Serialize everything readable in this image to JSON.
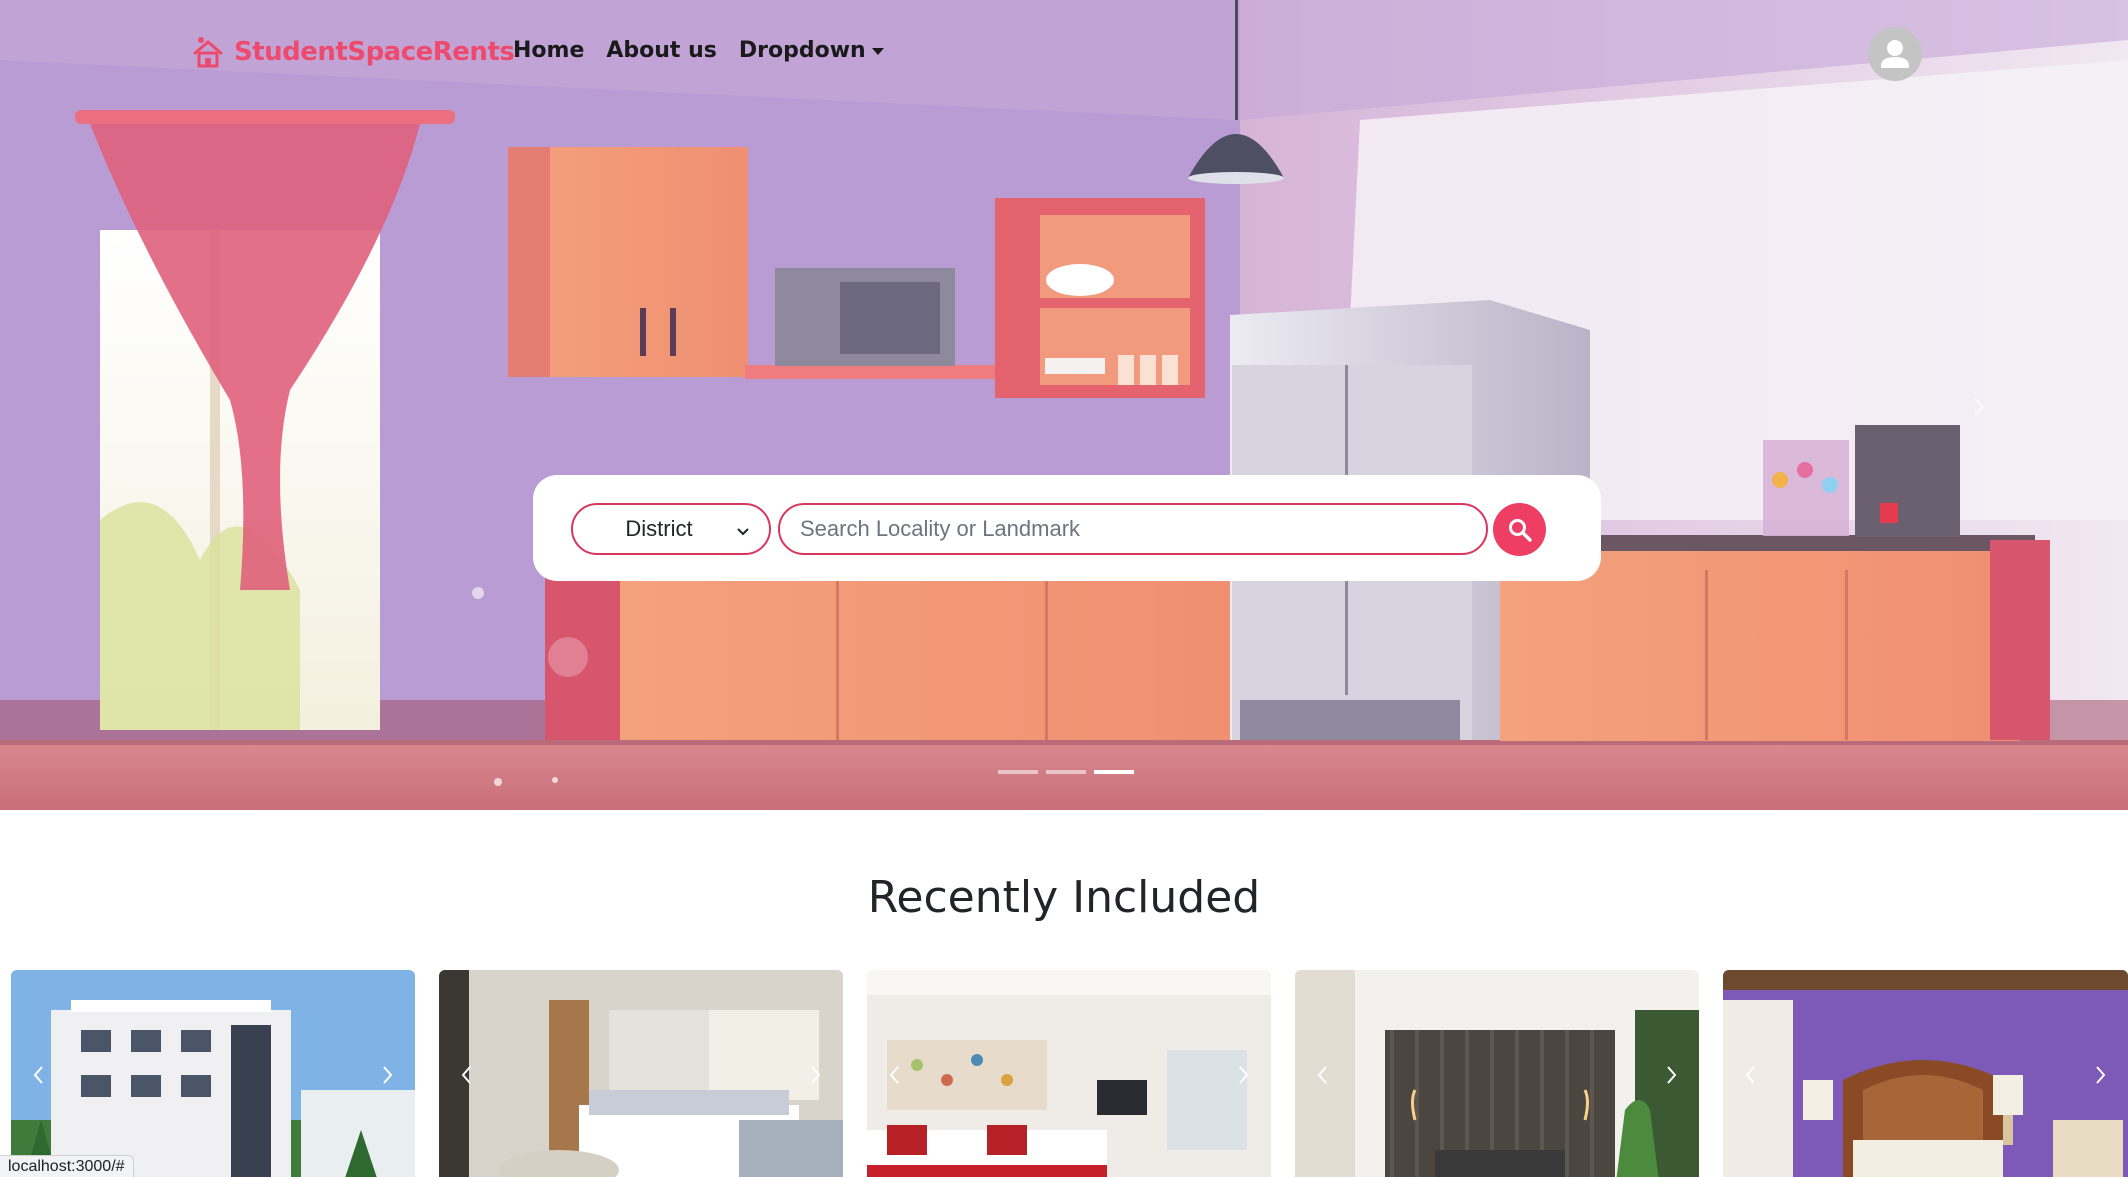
{
  "navbar": {
    "brand": "StudentSpaceRents",
    "links": [
      {
        "label": "Home"
      },
      {
        "label": "About us"
      },
      {
        "label": "Dropdown"
      }
    ],
    "avatar_icon": "user-icon"
  },
  "hero": {
    "search": {
      "district_label": "District",
      "placeholder": "Search Locality or Landmark",
      "button_icon": "search-icon"
    },
    "carousel": {
      "slides": 3,
      "active_index": 2
    },
    "colors": {
      "accent": "#ef3e64",
      "brand": "#ee4a6e"
    }
  },
  "recent": {
    "title": "Recently Included",
    "cards": [
      {
        "image": "apartment-building-image"
      },
      {
        "image": "bedroom-with-sofa-image"
      },
      {
        "image": "hotel-twin-bedroom-image"
      },
      {
        "image": "modern-dark-bedroom-image"
      },
      {
        "image": "ornate-purple-bedroom-image"
      }
    ]
  },
  "status_bar": {
    "url": "localhost:3000/#"
  }
}
